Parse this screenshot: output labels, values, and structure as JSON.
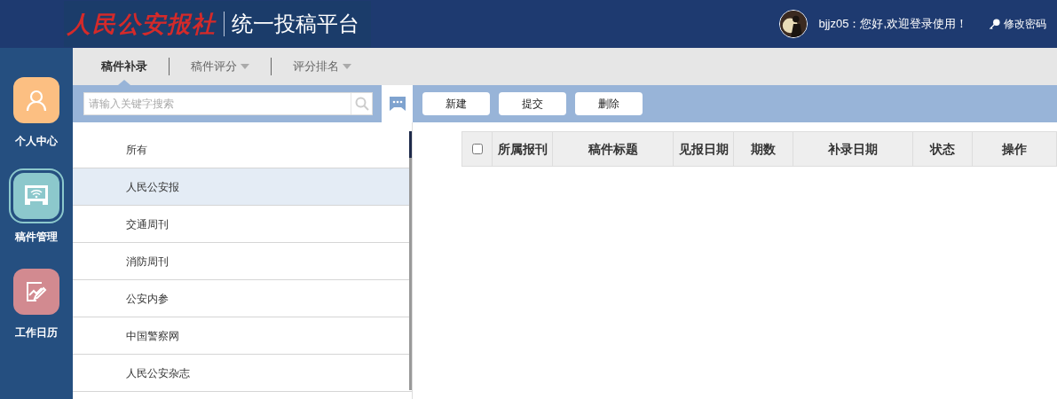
{
  "header": {
    "logo_text": "人民公安报社",
    "title": "统一投稿平台",
    "greeting": "bjjz05：您好,欢迎登录使用！",
    "change_password": "修改密码"
  },
  "sidebar": {
    "items": [
      {
        "label": "个人中心",
        "kind": "person",
        "color": "#fcbf82",
        "selected": false
      },
      {
        "label": "稿件管理",
        "kind": "monitor",
        "color": "#8cc8cc",
        "selected": true
      },
      {
        "label": "工作日历",
        "kind": "chart",
        "color": "#d28a90",
        "selected": false
      }
    ]
  },
  "tabs": [
    {
      "label": "稿件补录",
      "selected": true,
      "dropdown": false
    },
    {
      "label": "稿件评分",
      "selected": false,
      "dropdown": true
    },
    {
      "label": "评分排名",
      "selected": false,
      "dropdown": true
    }
  ],
  "search": {
    "placeholder": "请输入关键字搜索"
  },
  "buttons": [
    "新建",
    "提交",
    "删除"
  ],
  "publications": [
    {
      "label": "所有",
      "selected": false
    },
    {
      "label": "人民公安报",
      "selected": true
    },
    {
      "label": "交通周刊",
      "selected": false
    },
    {
      "label": "消防周刊",
      "selected": false
    },
    {
      "label": "公安内参",
      "selected": false
    },
    {
      "label": "中国警察网",
      "selected": false
    },
    {
      "label": "人民公安杂志",
      "selected": false
    }
  ],
  "table": {
    "select_all_checked": false,
    "columns": [
      "所属报刊",
      "稿件标题",
      "见报日期",
      "期数",
      "补录日期",
      "状态",
      "操作"
    ]
  }
}
